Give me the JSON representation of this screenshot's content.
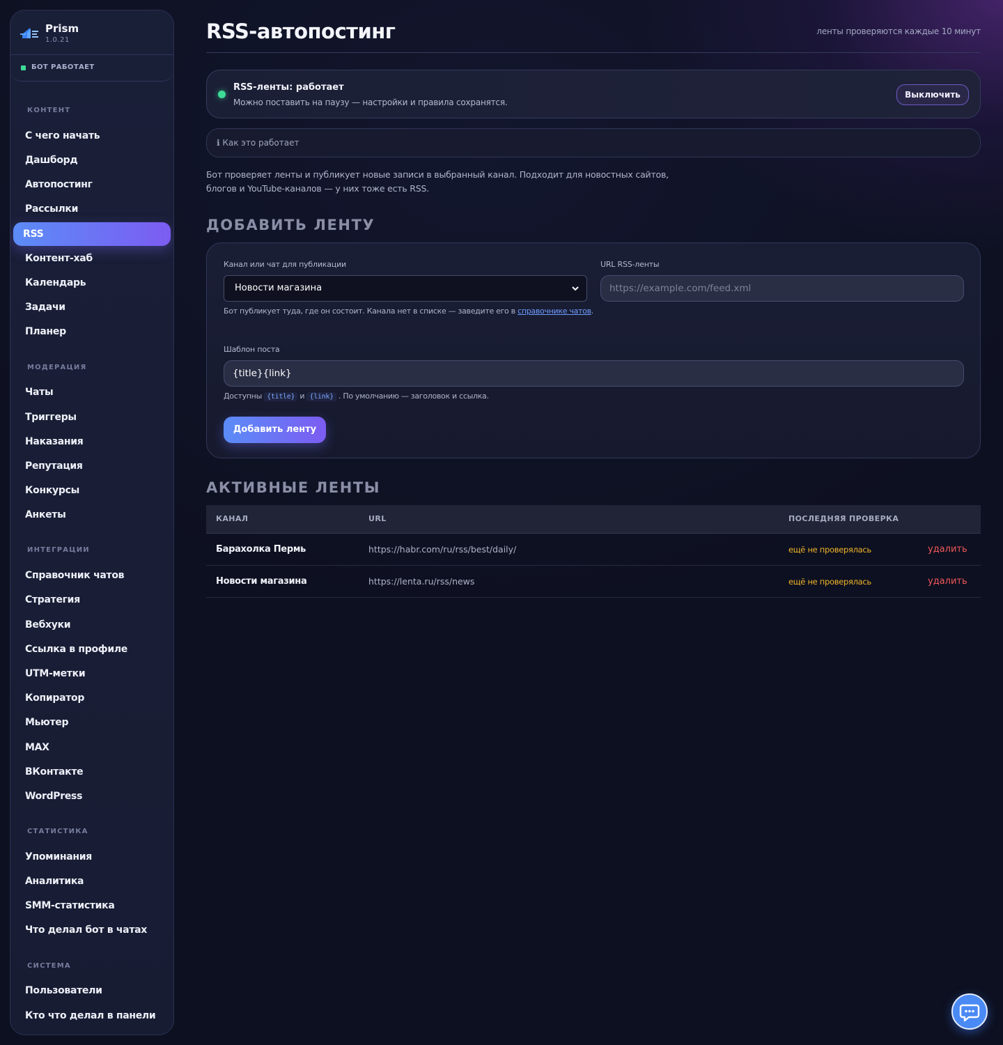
{
  "brand": {
    "name": "Prism",
    "version": "1.0.21"
  },
  "bot_status": "БОТ РАБОТАЕТ",
  "nav": {
    "sections": [
      {
        "title": "КОНТЕНТ",
        "items": [
          "С чего начать",
          "Дашборд",
          "Автопостинг",
          "Рассылки",
          "RSS",
          "Контент-хаб",
          "Календарь",
          "Задачи",
          "Планер"
        ]
      },
      {
        "title": "МОДЕРАЦИЯ",
        "items": [
          "Чаты",
          "Триггеры",
          "Наказания",
          "Репутация",
          "Конкурсы",
          "Анкеты"
        ]
      },
      {
        "title": "ИНТЕГРАЦИИ",
        "items": [
          "Справочник чатов",
          "Стратегия",
          "Вебхуки",
          "Ссылка в профиле",
          "UTM-метки",
          "Копиратор",
          "Мьютер",
          "MAX",
          "ВКонтакте",
          "WordPress"
        ]
      },
      {
        "title": "СТАТИСТИКА",
        "items": [
          "Упоминания",
          "Аналитика",
          "SMM-статистика",
          "Что делал бот в чатах"
        ]
      },
      {
        "title": "СИСТЕМА",
        "items": [
          "Пользователи",
          "Кто что делал в панели"
        ]
      }
    ],
    "active": "RSS"
  },
  "page": {
    "title": "RSS-автопостинг",
    "note": "ленты проверяются каждые 10 минут"
  },
  "status_card": {
    "title": "RSS-ленты: работает",
    "subtitle": "Можно поставить на паузу — настройки и правила сохранятся.",
    "toggle_label": "Выключить"
  },
  "how_it_works": "ℹ Как это работает",
  "description": "Бот проверяет ленты и публикует новые записи в выбранный канал. Подходит для новостных сайтов, блогов и YouTube-каналов — у них тоже есть RSS.",
  "add_feed": {
    "heading": "ДОБАВИТЬ ЛЕНТУ",
    "channel_label": "Канал или чат для публикации",
    "channel_value": "Новости магазина",
    "url_label": "URL RSS-ленты",
    "url_placeholder": "https://example.com/feed.xml",
    "channel_hint": "Бот публикует туда, где он состоит. Канала нет в списке — заведите его в ",
    "channel_hint_link": "справочнике чатов",
    "channel_hint_end": ".",
    "template_label": "Шаблон поста",
    "template_value": "{title}{link}",
    "template_hint_prefix": "Доступны",
    "var_title": "{title}",
    "template_hint_and": "и",
    "var_link": "{link}",
    "template_hint_suffix": ". По умолчанию — заголовок и ссылка.",
    "submit_label": "Добавить ленту"
  },
  "active_feeds": {
    "heading": "АКТИВНЫЕ ЛЕНТЫ",
    "columns": [
      "КАНАЛ",
      "URL",
      "ПОСЛЕДНЯЯ ПРОВЕРКА"
    ],
    "rows": [
      {
        "channel": "Барахолка Пермь",
        "url": "https://habr.com/ru/rss/best/daily/",
        "last_check": "ещё не проверялась",
        "action": "удалить"
      },
      {
        "channel": "Новости магазина",
        "url": "https://lenta.ru/rss/news",
        "last_check": "ещё не проверялась",
        "action": "удалить"
      }
    ]
  },
  "colors": {
    "accent_start": "#5b8cf7",
    "accent_end": "#7c5cf2",
    "ok": "#3ddc97",
    "warn": "#f0b429",
    "danger": "#f0585a"
  },
  "icons": {
    "brand": "prism-logo-icon",
    "chat_fab": "chat-bubble-icon",
    "select": "chevron-down-icon"
  }
}
